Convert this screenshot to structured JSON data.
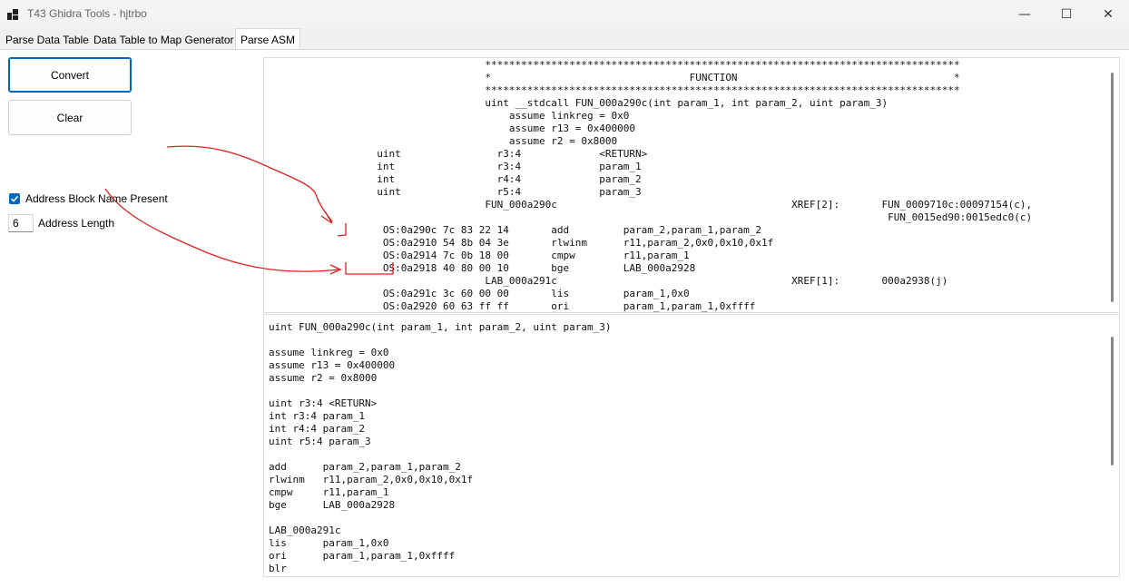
{
  "window": {
    "title": "T43 Ghidra Tools - hjtrbo",
    "minimize_glyph": "—",
    "maximize_glyph": "☐",
    "close_glyph": "✕"
  },
  "tabs": [
    {
      "label": "Parse Data Table",
      "active": false
    },
    {
      "label": "Data Table to Map Generator",
      "active": false
    },
    {
      "label": "Parse ASM",
      "active": true
    }
  ],
  "controls": {
    "convert_label": "Convert",
    "clear_label": "Clear",
    "address_block_label": "Address Block Name Present",
    "address_block_checked": true,
    "address_length_label": "Address Length",
    "address_length_value": "6"
  },
  "input_code": "                                    *******************************************************************************\n                                    *                                 FUNCTION                                    *\n                                    *******************************************************************************\n                                    uint __stdcall FUN_000a290c(int param_1, int param_2, uint param_3)\n                                        assume linkreg = 0x0\n                                        assume r13 = 0x400000\n                                        assume r2 = 0x8000\n                  uint                r3:4             <RETURN>\n                  int                 r3:4             param_1\n                  int                 r4:4             param_2\n                  uint                r5:4             param_3\n                                    FUN_000a290c                                       XREF[2]:       FUN_0009710c:00097154(c),\n                                                                                                       FUN_0015ed90:0015edc0(c)\n                   OS:0a290c 7c 83 22 14       add         param_2,param_1,param_2\n                   OS:0a2910 54 8b 04 3e       rlwinm      r11,param_2,0x0,0x10,0x1f\n                   OS:0a2914 7c 0b 18 00       cmpw        r11,param_1\n                   OS:0a2918 40 80 00 10       bge         LAB_000a2928\n                                    LAB_000a291c                                       XREF[1]:       000a2938(j)\n                   OS:0a291c 3c 60 00 00       lis         param_1,0x0\n                   OS:0a2920 60 63 ff ff       ori         param_1,param_1,0xffff",
  "output_code": "uint FUN_000a290c(int param_1, int param_2, uint param_3)\n\nassume linkreg = 0x0\nassume r13 = 0x400000\nassume r2 = 0x8000\n\nuint r3:4 <RETURN>\nint r3:4 param_1\nint r4:4 param_2\nuint r5:4 param_3\n\nadd      param_2,param_1,param_2\nrlwinm   r11,param_2,0x0,0x10,0x1f\ncmpw     r11,param_1\nbge      LAB_000a2928\n\nLAB_000a291c\nlis      param_1,0x0\nori      param_1,param_1,0xffff\nblr",
  "colors": {
    "accent": "#0067c0",
    "annotation": "#e02020"
  }
}
